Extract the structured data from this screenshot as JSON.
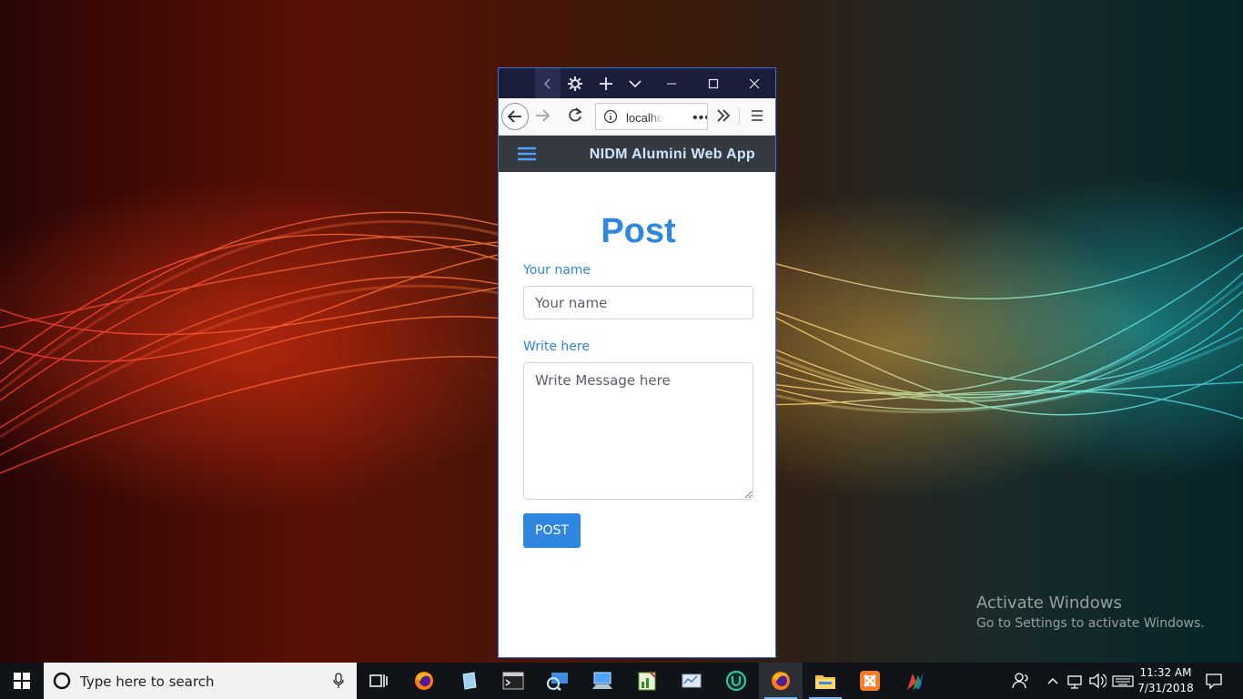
{
  "desktop": {
    "activate_title": "Activate Windows",
    "activate_subtitle": "Go to Settings to activate Windows."
  },
  "browser": {
    "url": "localhost",
    "page_actions_label": "•••"
  },
  "app": {
    "title": "NIDM Alumini Web App"
  },
  "form": {
    "heading": "Post",
    "name_label": "Your name",
    "name_placeholder": "Your name",
    "message_label": "Write here",
    "message_placeholder": "Write Message here",
    "submit_label": "POST"
  },
  "taskbar": {
    "search_placeholder": "Type here to search",
    "time": "11:32 AM",
    "date": "7/31/2018",
    "pinned": [
      "firefox-icon",
      "notepad-icon",
      "terminal-icon",
      "network-icon",
      "computer-icon",
      "chart-app-icon",
      "control-panel-icon",
      "u-app-icon",
      "firefox-icon",
      "file-explorer-icon",
      "xampp-icon",
      "pen-app-icon"
    ]
  },
  "colors": {
    "accent": "#2e86de",
    "app_bar": "#343a40",
    "titlebar": "#1b1e3a"
  }
}
